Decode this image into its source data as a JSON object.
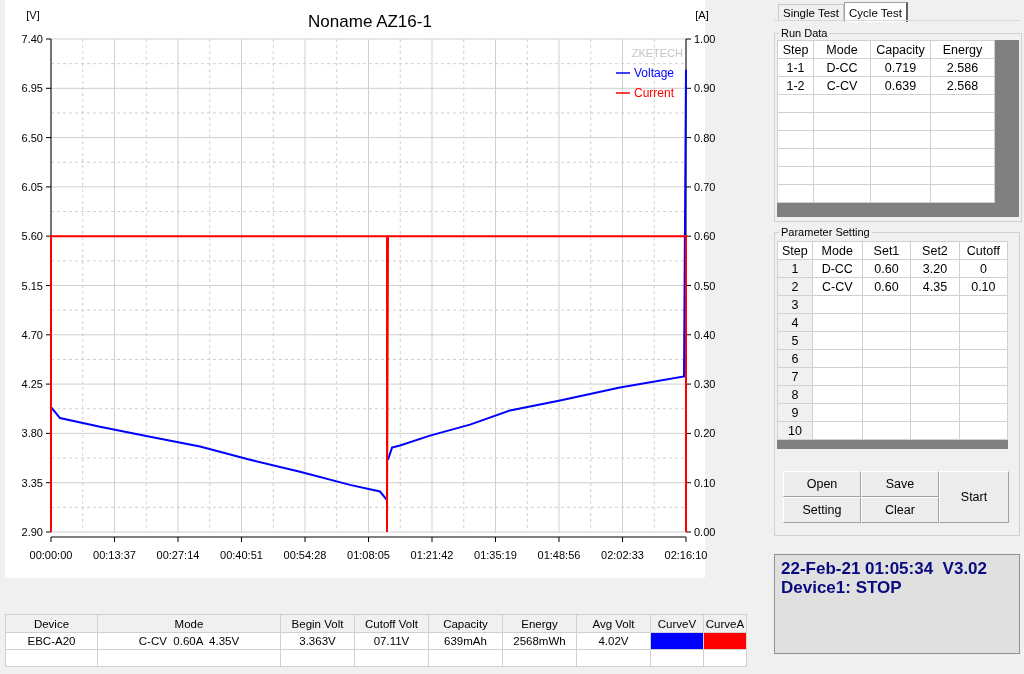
{
  "chart": {
    "brand": "ZKETECH",
    "chart_data": {
      "type": "line",
      "title": "Noname AZ16-1",
      "grid": true,
      "legend": "top-right",
      "ylabel": "[V]",
      "y2label": "[A]",
      "x": [
        0,
        0,
        116,
        630,
        1274,
        1917,
        2560,
        3204,
        3847,
        4233,
        4323,
        4323,
        4336,
        4387,
        4490,
        4876,
        5391,
        5906,
        6549,
        7320,
        8144,
        8170,
        8170
      ],
      "series": [
        {
          "name": "Voltage",
          "color": "#0000ff",
          "values": [
            null,
            4.04,
            3.94,
            3.86,
            3.77,
            3.68,
            3.56,
            3.45,
            3.33,
            3.27,
            3.19,
            null,
            3.56,
            3.67,
            3.69,
            3.78,
            3.88,
            4.01,
            4.1,
            4.22,
            4.32,
            7.12,
            null
          ]
        },
        {
          "name": "Current",
          "color": "#ff0000",
          "axis": "y2",
          "values": [
            0,
            0.6,
            0.6,
            0.6,
            0.6,
            0.6,
            0.6,
            0.6,
            0.6,
            0.6,
            0.6,
            0,
            0.6,
            0.6,
            0.6,
            0.6,
            0.6,
            0.6,
            0.6,
            0.6,
            0.6,
            0.6,
            0
          ]
        }
      ],
      "xlim": [
        0,
        8170
      ],
      "ylim": [
        2.9,
        7.4
      ],
      "y2lim": [
        0,
        1
      ],
      "xticks": [
        {
          "value": 0,
          "label": "00:00:00"
        },
        {
          "value": 817,
          "label": "00:13:37"
        },
        {
          "value": 1634,
          "label": "00:27:14"
        },
        {
          "value": 2451,
          "label": "00:40:51"
        },
        {
          "value": 3268,
          "label": "00:54:28"
        },
        {
          "value": 4085,
          "label": "01:08:05"
        },
        {
          "value": 4902,
          "label": "01:21:42"
        },
        {
          "value": 5719,
          "label": "01:35:19"
        },
        {
          "value": 6536,
          "label": "01:48:56"
        },
        {
          "value": 7353,
          "label": "02:02:33"
        },
        {
          "value": 8170,
          "label": "02:16:10"
        }
      ],
      "yticks": [
        {
          "value": 2.9,
          "label": "2.90"
        },
        {
          "value": 3.35,
          "label": "3.35"
        },
        {
          "value": 3.8,
          "label": "3.80"
        },
        {
          "value": 4.25,
          "label": "4.25"
        },
        {
          "value": 4.7,
          "label": "4.70"
        },
        {
          "value": 5.15,
          "label": "5.15"
        },
        {
          "value": 5.6,
          "label": "5.60"
        },
        {
          "value": 6.05,
          "label": "6.05"
        },
        {
          "value": 6.5,
          "label": "6.50"
        },
        {
          "value": 6.95,
          "label": "6.95"
        },
        {
          "value": 7.4,
          "label": "7.40"
        }
      ],
      "y2ticks": [
        {
          "value": 0,
          "label": "0.00"
        },
        {
          "value": 0.1,
          "label": "0.10"
        },
        {
          "value": 0.2,
          "label": "0.20"
        },
        {
          "value": 0.3,
          "label": "0.30"
        },
        {
          "value": 0.4,
          "label": "0.40"
        },
        {
          "value": 0.5,
          "label": "0.50"
        },
        {
          "value": 0.6,
          "label": "0.60"
        },
        {
          "value": 0.7,
          "label": "0.70"
        },
        {
          "value": 0.8,
          "label": "0.80"
        },
        {
          "value": 0.9,
          "label": "0.90"
        },
        {
          "value": 1.0,
          "label": "1.00"
        }
      ]
    }
  },
  "summary_table": {
    "columns": [
      "Device",
      "Mode",
      "Begin Volt",
      "Cutoff Volt",
      "Capacity",
      "Energy",
      "Avg Volt",
      "CurveV",
      "CurveA"
    ],
    "rows": [
      {
        "cells": [
          "EBC-A20",
          "C-CV  0.60A  4.35V",
          "3.363V",
          "07.11V",
          "639mAh",
          "2568mWh",
          "4.02V"
        ],
        "curves": [
          {
            "color": "#0000ff"
          },
          {
            "color": "#ff0000"
          }
        ]
      }
    ]
  },
  "tabs": [
    {
      "label": "Single Test",
      "selected": false
    },
    {
      "label": "Cycle Test",
      "selected": true
    }
  ],
  "run_data": {
    "title": "Run Data",
    "columns": [
      "Step",
      "Mode",
      "Capacity",
      "Energy"
    ],
    "rows": [
      [
        "1-1",
        "D-CC",
        "0.719",
        "2.586"
      ],
      [
        "1-2",
        "C-CV",
        "0.639",
        "2.568"
      ]
    ]
  },
  "parameter_setting": {
    "title": "Parameter Setting",
    "columns": [
      "Step",
      "Mode",
      "Set1",
      "Set2",
      "Cutoff"
    ],
    "rows": [
      [
        "1",
        "D-CC",
        "0.60",
        "3.20",
        "0"
      ],
      [
        "2",
        "C-CV",
        "0.60",
        "4.35",
        "0.10"
      ],
      [
        "3"
      ],
      [
        "4"
      ],
      [
        "5"
      ],
      [
        "6"
      ],
      [
        "7"
      ],
      [
        "8"
      ],
      [
        "9"
      ],
      [
        "10"
      ]
    ]
  },
  "buttons": {
    "open": "Open",
    "save": "Save",
    "setting": "Setting",
    "clear": "Clear",
    "start": "Start"
  },
  "status": {
    "line_1": "22-Feb-21 01:05:34  V3.02",
    "line_2": "Device1: STOP"
  }
}
